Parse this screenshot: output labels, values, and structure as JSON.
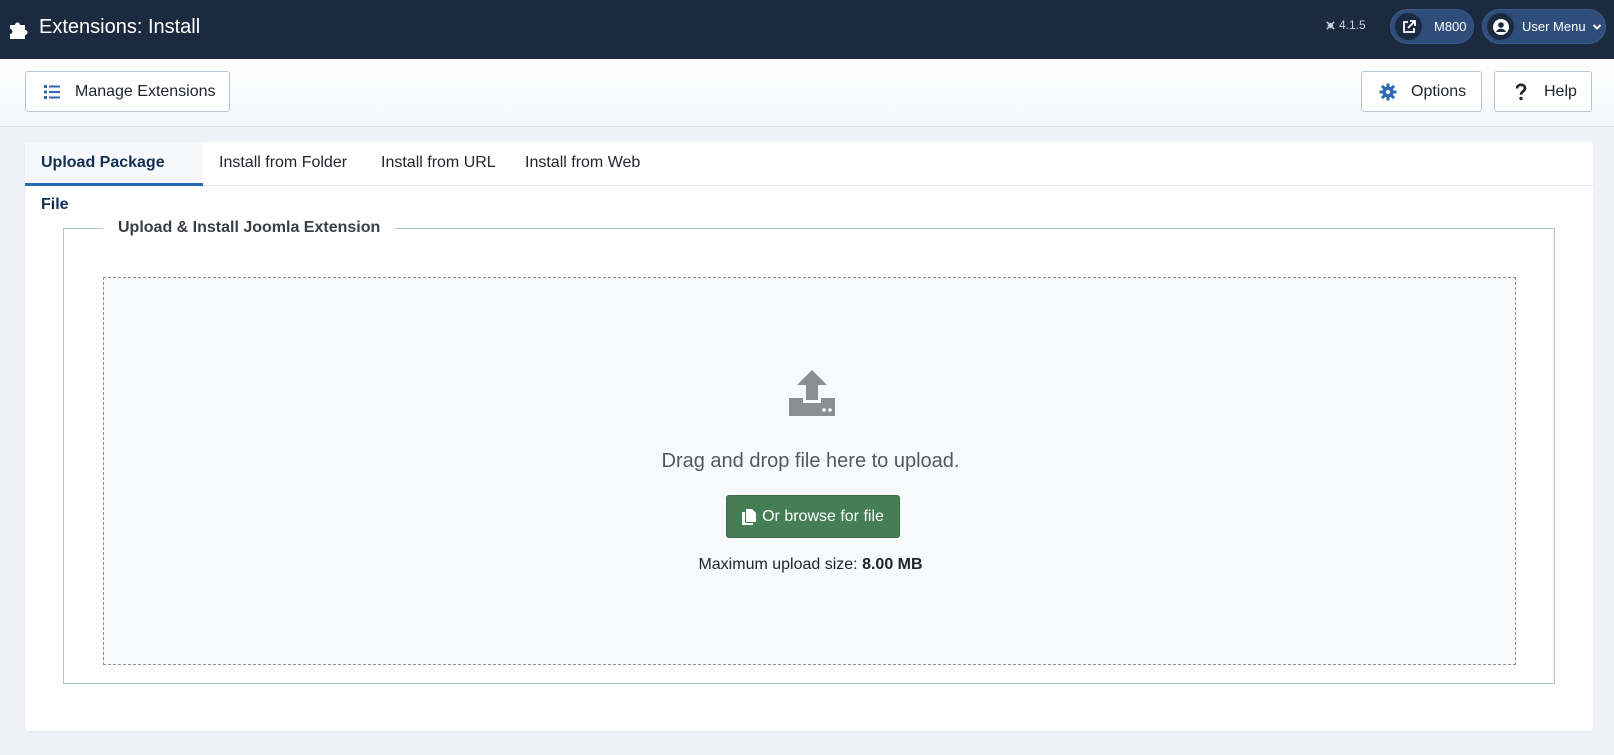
{
  "header": {
    "title": "Extensions: Install",
    "version": "4.1.5",
    "site_label": "M800",
    "user_menu_label": "User Menu"
  },
  "toolbar": {
    "manage_label": "Manage Extensions",
    "options_label": "Options",
    "help_label": "Help"
  },
  "tabs": [
    {
      "label": "Upload Package File",
      "active": true
    },
    {
      "label": "Install from Folder",
      "active": false
    },
    {
      "label": "Install from URL",
      "active": false
    },
    {
      "label": "Install from Web",
      "active": false
    }
  ],
  "upload": {
    "legend": "Upload & Install Joomla Extension",
    "drop_text": "Drag and drop file here to upload.",
    "browse_label": "Or browse for file",
    "max_size_label": "Maximum upload size:",
    "max_size_value": "8.00 MB"
  },
  "icons": {
    "header": "puzzle-icon",
    "manage": "list-icon",
    "options": "gear-icon",
    "help": "question-icon",
    "site": "external-link-icon",
    "user": "user-circle-icon",
    "upload": "upload-icon",
    "browse": "copy-icon"
  },
  "colors": {
    "header_bg": "#1c2a3f",
    "accent": "#2a69b8",
    "success": "#457d54"
  }
}
